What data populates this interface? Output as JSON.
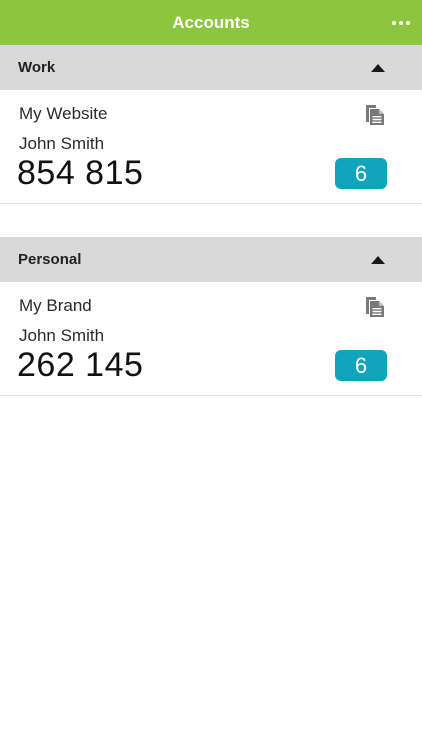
{
  "header": {
    "title": "Accounts",
    "more_icon": "more-horizontal-icon"
  },
  "colors": {
    "nav_bar": "#8cc63f",
    "section_header": "#d9d9d9",
    "badge": "#12a4bd"
  },
  "sections": [
    {
      "title": "Work",
      "collapse_icon": "triangle-up-icon",
      "account": {
        "name": "My Website",
        "user": "John Smith",
        "code": "854 815",
        "countdown": "6",
        "copy_icon": "copy-icon"
      }
    },
    {
      "title": "Personal",
      "collapse_icon": "triangle-up-icon",
      "account": {
        "name": "My Brand",
        "user": "John Smith",
        "code": "262 145",
        "countdown": "6",
        "copy_icon": "copy-icon"
      }
    }
  ]
}
